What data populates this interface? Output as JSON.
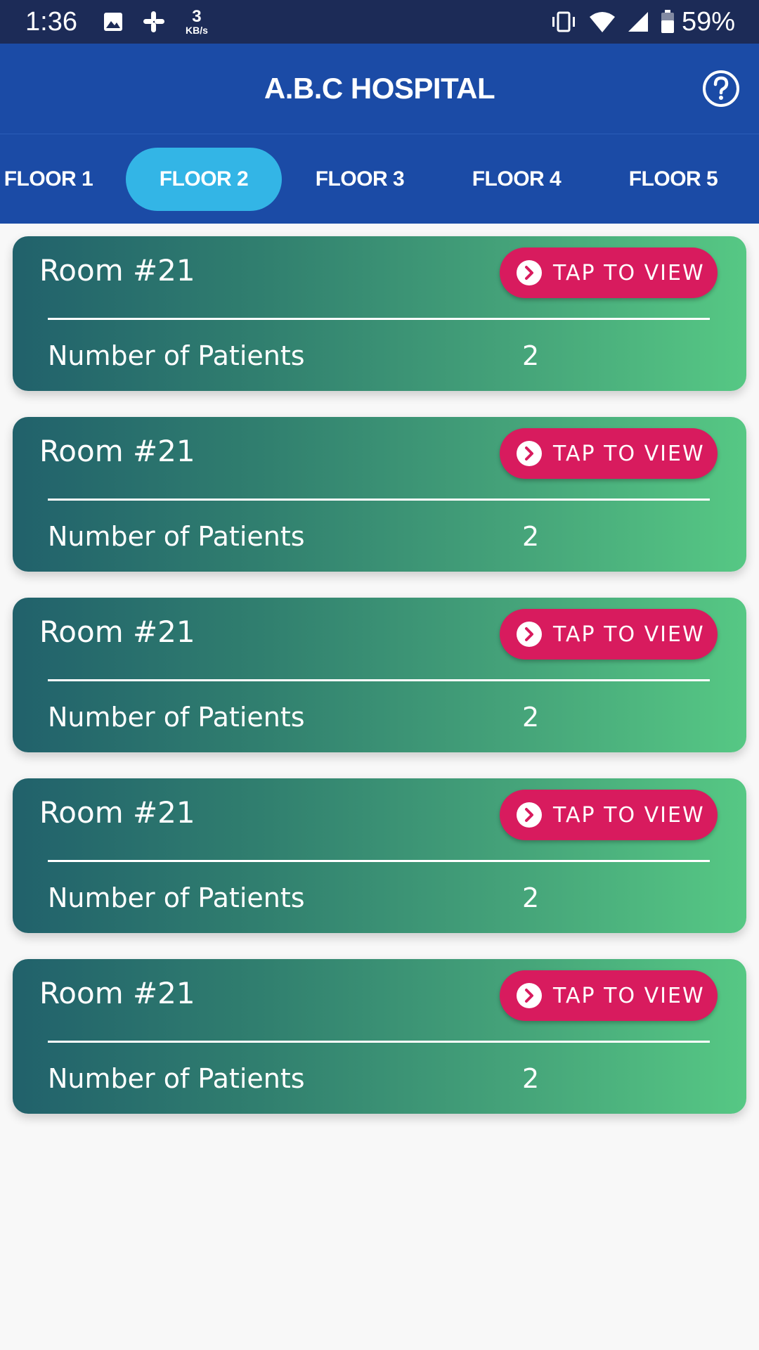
{
  "status_bar": {
    "time": "1:36",
    "speed_value": "3",
    "speed_unit": "KB/s",
    "battery": "59%",
    "icons": [
      "image-icon",
      "slack-icon",
      "vibrate-icon",
      "wifi-icon",
      "signal-icon",
      "battery-icon"
    ]
  },
  "app_bar": {
    "title": "A.B.C HOSPITAL",
    "help_icon": "help-circle-icon"
  },
  "tabs": [
    {
      "label": "FLOOR 1",
      "active": false
    },
    {
      "label": "FLOOR 2",
      "active": true
    },
    {
      "label": "FLOOR 3",
      "active": false
    },
    {
      "label": "FLOOR 4",
      "active": false
    },
    {
      "label": "FLOOR 5",
      "active": false
    }
  ],
  "rooms": [
    {
      "title": "Room #21",
      "button_label": "TAP TO VIEW",
      "patients_label": "Number of Patients",
      "patients_count": "2"
    },
    {
      "title": "Room #21",
      "button_label": "TAP TO VIEW",
      "patients_label": "Number of Patients",
      "patients_count": "2"
    },
    {
      "title": "Room #21",
      "button_label": "TAP TO VIEW",
      "patients_label": "Number of Patients",
      "patients_count": "2"
    },
    {
      "title": "Room #21",
      "button_label": "TAP TO VIEW",
      "patients_label": "Number of Patients",
      "patients_count": "2"
    },
    {
      "title": "Room #21",
      "button_label": "TAP TO VIEW",
      "patients_label": "Number of Patients",
      "patients_count": "2"
    }
  ],
  "colors": {
    "status_bar": "#1c2b57",
    "app_bar": "#1b4ba6",
    "active_tab": "#33b5e6",
    "button": "#d81b5e",
    "card_gradient_start": "#21616b",
    "card_gradient_end": "#56c884"
  }
}
